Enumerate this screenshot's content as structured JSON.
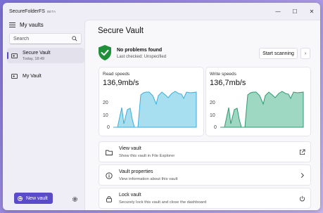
{
  "window": {
    "app_title": "SecureFolderFS",
    "beta_badge": "BETA",
    "minimize_glyph": "—",
    "maximize_glyph": "☐",
    "close_glyph": "✕"
  },
  "sidebar": {
    "title": "My vaults",
    "search_placeholder": "Search",
    "vaults": [
      {
        "name": "Secure Vault",
        "subtitle": "Today, 18:49",
        "selected": true
      },
      {
        "name": "My Vault",
        "subtitle": "",
        "selected": false
      }
    ],
    "new_vault_label": "New vault"
  },
  "main": {
    "page_title": "Secure Vault",
    "health": {
      "status_title": "No problems found",
      "last_checked": "Last checked: Unspecified",
      "scan_button": "Start scanning",
      "chevron": "›"
    },
    "read": {
      "label": "Read speeds",
      "value": "136,9mb/s",
      "color": "#3aaed8",
      "fill": "#a8dff0"
    },
    "write": {
      "label": "Write speeds",
      "value": "136,7mb/s",
      "color": "#2f9a70",
      "fill": "#9ed8c2"
    },
    "graph_ticks": [
      "20",
      "10",
      "0"
    ],
    "actions": [
      {
        "title": "View vault",
        "subtitle": "Show this vault in File Explorer",
        "icon": "folder-icon",
        "trailing": "open-external-icon"
      },
      {
        "title": "Vault properties",
        "subtitle": "View information about this vault",
        "icon": "info-icon",
        "trailing": "chevron-right-icon"
      },
      {
        "title": "Lock vault",
        "subtitle": "Securely lock this vault and close the dashboard",
        "icon": "lock-icon",
        "trailing": "power-icon"
      }
    ]
  },
  "colors": {
    "accent": "#5a4bc8",
    "shield": "#1f8f3a"
  }
}
